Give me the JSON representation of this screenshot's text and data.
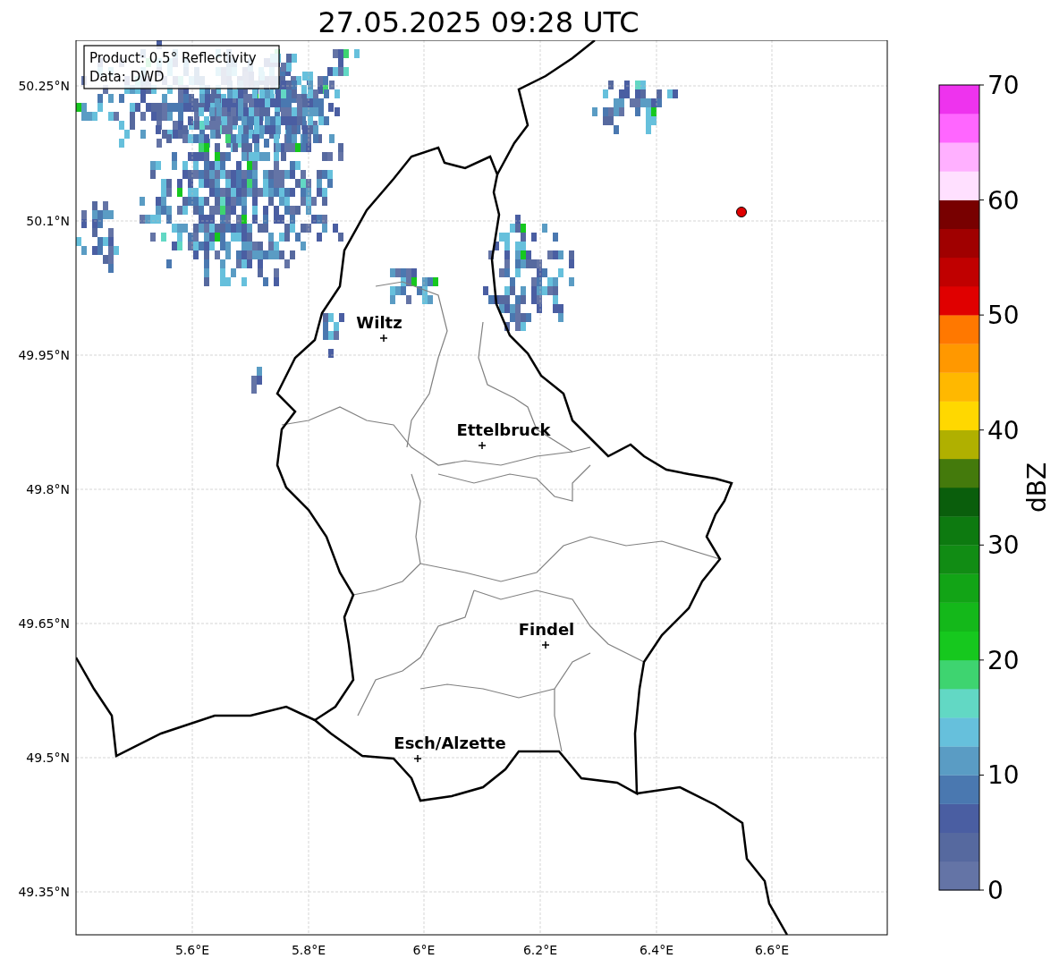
{
  "title": "27.05.2025 09:28 UTC",
  "map": {
    "info_lines": [
      "Product: 0.5° Reflectivity",
      "Data: DWD"
    ],
    "y_ticks": [
      "50.25°N",
      "50.1°N",
      "49.95°N",
      "49.8°N",
      "49.65°N",
      "49.5°N",
      "49.35°N"
    ],
    "x_ticks": [
      "5.6°E",
      "5.8°E",
      "6°E",
      "6.2°E",
      "6.4°E",
      "6.6°E"
    ],
    "cities": [
      {
        "name": "Wiltz"
      },
      {
        "name": "Ettelbruck"
      },
      {
        "name": "Findel"
      },
      {
        "name": "Esch/Alzette"
      }
    ]
  },
  "colorbar": {
    "label": "dBZ",
    "ticks": [
      "70",
      "60",
      "50",
      "40",
      "30",
      "20",
      "10",
      "0"
    ],
    "bins": [
      {
        "color": "#6474a6"
      },
      {
        "color": "#56699f"
      },
      {
        "color": "#4a5ea2"
      },
      {
        "color": "#4a78b0"
      },
      {
        "color": "#5a9cc4"
      },
      {
        "color": "#66c0dc"
      },
      {
        "color": "#62d8c4"
      },
      {
        "color": "#3ed470"
      },
      {
        "color": "#16c81e"
      },
      {
        "color": "#14b81a"
      },
      {
        "color": "#12a416"
      },
      {
        "color": "#118c14"
      },
      {
        "color": "#0d7a10"
      },
      {
        "color": "#0a5e0c"
      },
      {
        "color": "#447a0c"
      },
      {
        "color": "#b0b000"
      },
      {
        "color": "#ffd800"
      },
      {
        "color": "#ffb800"
      },
      {
        "color": "#ff9800"
      },
      {
        "color": "#ff7800"
      },
      {
        "color": "#e00000"
      },
      {
        "color": "#c00000"
      },
      {
        "color": "#a00000"
      },
      {
        "color": "#780000"
      },
      {
        "color": "#ffe0ff"
      },
      {
        "color": "#ffb0ff"
      },
      {
        "color": "#ff66ff"
      },
      {
        "color": "#ee33ee"
      }
    ]
  }
}
